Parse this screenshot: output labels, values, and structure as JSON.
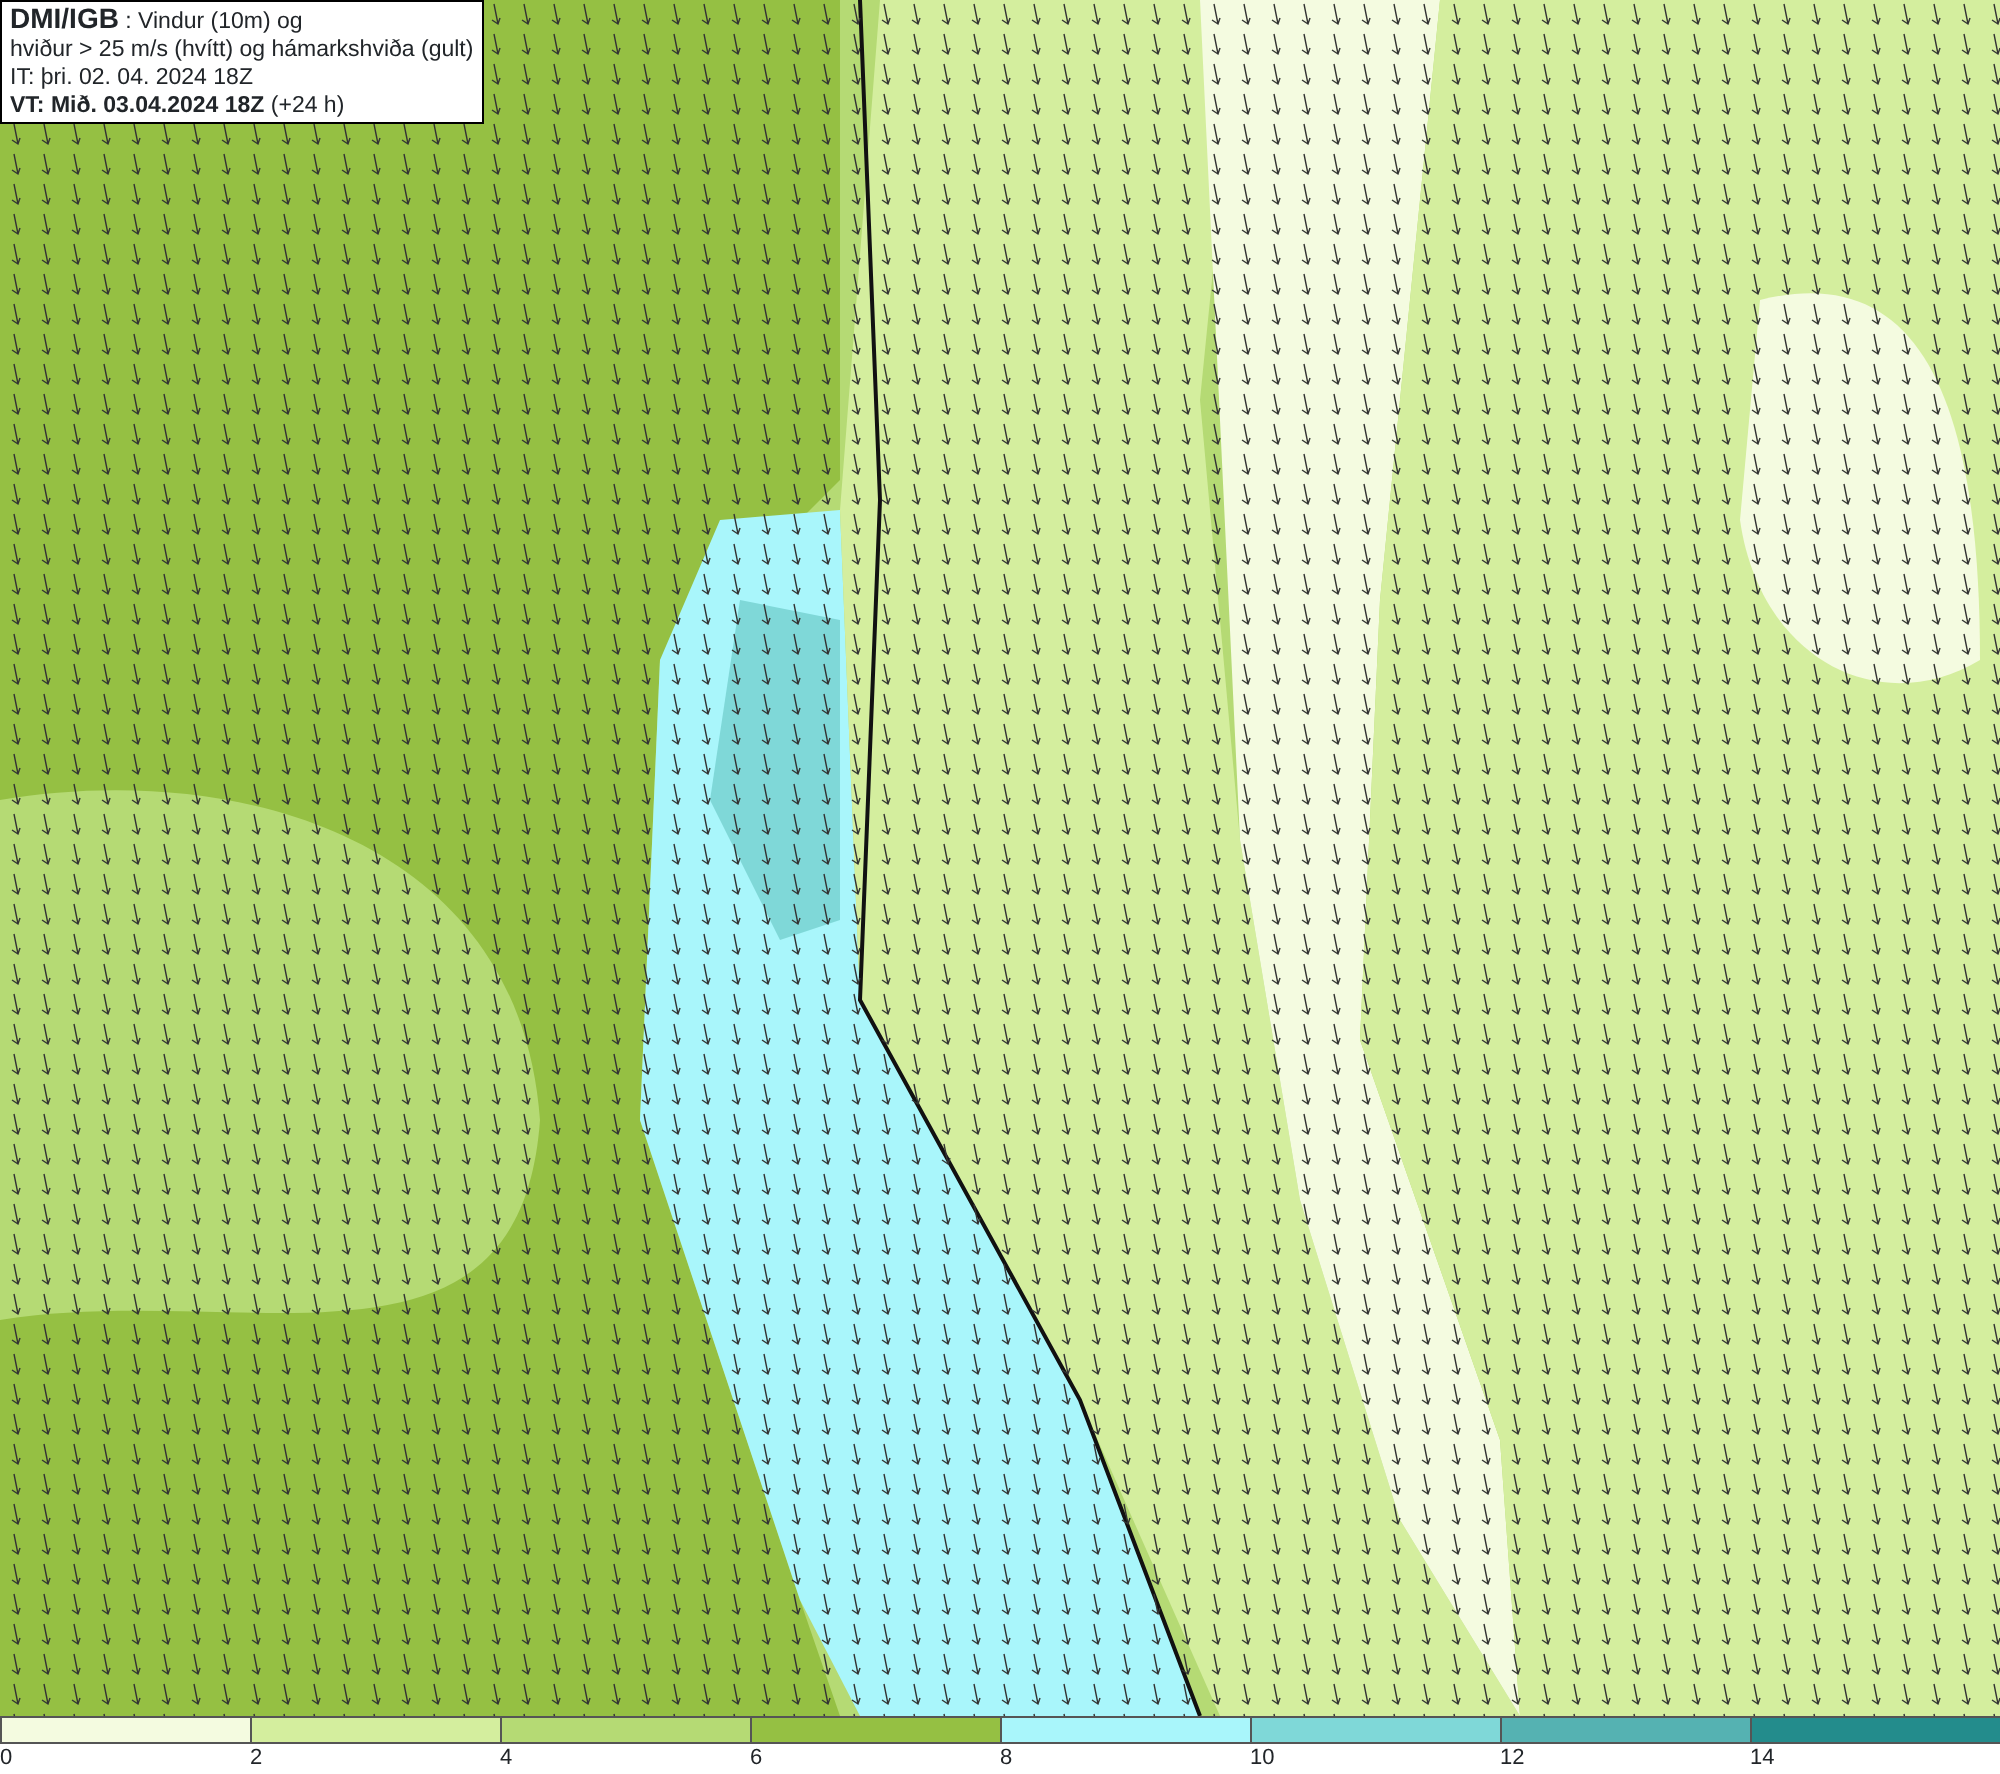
{
  "header": {
    "lines": [
      "**DMI/IGB** : Vindur (10m) og",
      "hviður > 25 m/s (hvítt) og hámarkshviða (gult)",
      "IT: þri. 02. 04. 2024 18Z",
      "**VT: Mið. 03.04.2024 18Z** (+24 h)"
    ]
  },
  "legend": [
    {
      "label": "0",
      "color": "#f4fbe0"
    },
    {
      "label": "2",
      "color": "#d4ee9e"
    },
    {
      "label": "4",
      "color": "#b5da74"
    },
    {
      "label": "6",
      "color": "#95c043"
    },
    {
      "label": "8",
      "color": "#a9f6fb"
    },
    {
      "label": "10",
      "color": "#7fd8d8"
    },
    {
      "label": "12",
      "color": "#55b2b2"
    },
    {
      "label": "14",
      "color": "#238c8c"
    }
  ]
}
